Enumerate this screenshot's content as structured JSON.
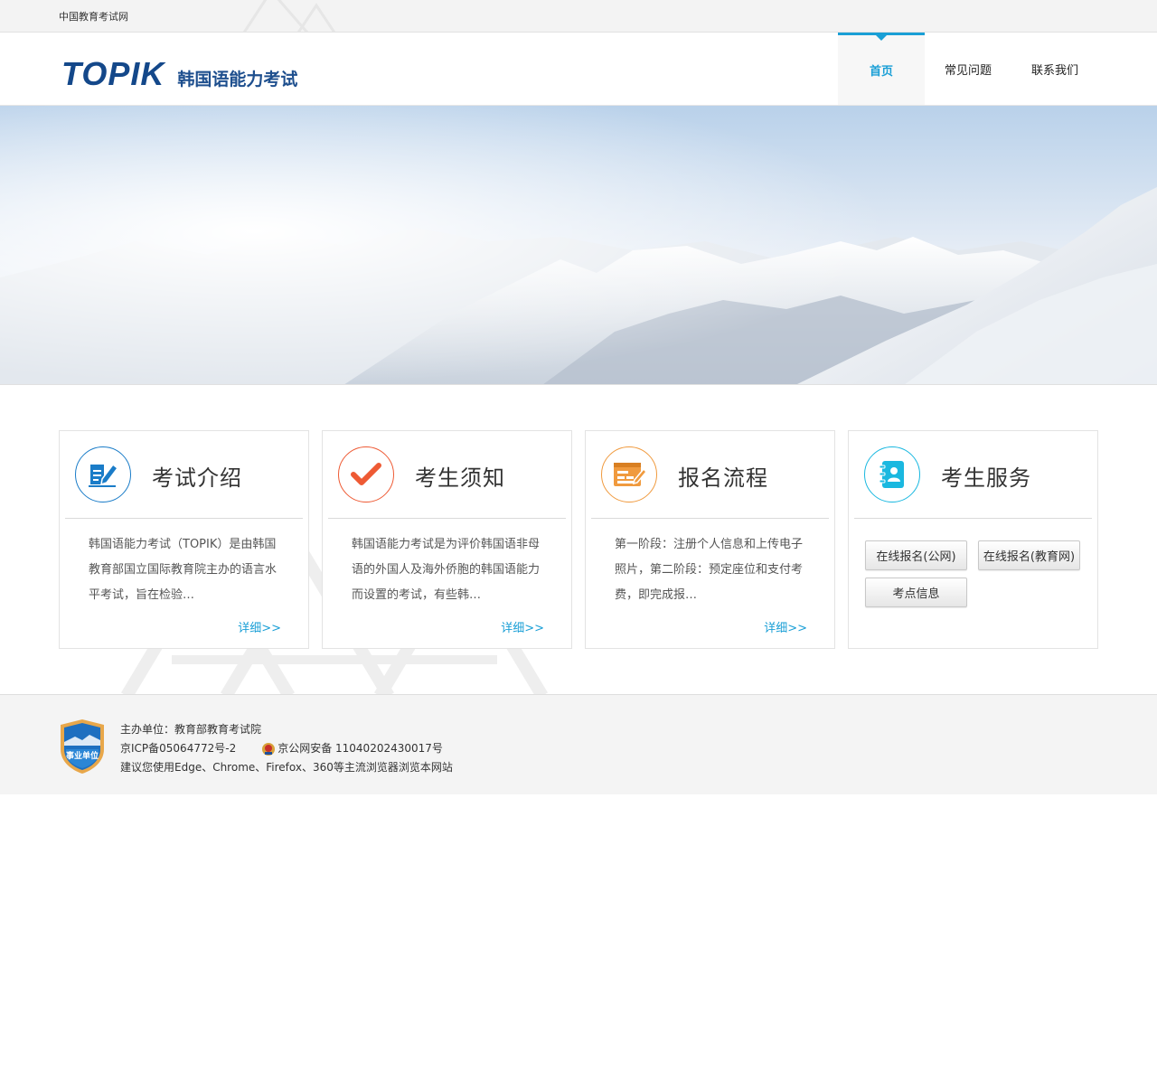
{
  "topbar": {
    "site_name": "中国教育考试网"
  },
  "header": {
    "logo_mark": "TOPIK",
    "logo_name": "韩国语能力考试",
    "nav": [
      {
        "label": "首页",
        "active": true
      },
      {
        "label": "常见问题",
        "active": false
      },
      {
        "label": "联系我们",
        "active": false
      }
    ]
  },
  "cards": [
    {
      "title": "考试介绍",
      "icon": "document-edit-icon",
      "color": "#1a7cc8",
      "text": "韩国语能力考试（TOPIK）是由韩国教育部国立国际教育院主办的语言水平考试，旨在检验…",
      "more": "详细>>"
    },
    {
      "title": "考生须知",
      "icon": "checkmark-icon",
      "color": "#ee5a34",
      "text": "韩国语能力考试是为评价韩国语非母语的外国人及海外侨胞的韩国语能力而设置的考试，有些韩…",
      "more": "详细>>"
    },
    {
      "title": "报名流程",
      "icon": "form-edit-icon",
      "color": "#f09a3e",
      "text": "第一阶段：注册个人信息和上传电子照片，第二阶段：预定座位和支付考费，即完成报…",
      "more": "详细>>"
    },
    {
      "title": "考生服务",
      "icon": "address-book-icon",
      "color": "#1ab8e0",
      "buttons": [
        "在线报名(公网)",
        "在线报名(教育网)",
        "考点信息"
      ]
    }
  ],
  "footer": {
    "host": "主办单位：教育部教育考试院",
    "icp": "京ICP备05064772号-2",
    "police_record": "京公网安备 11040202430017号",
    "browser_tip": "建议您使用Edge、Chrome、Firefox、360等主流浏览器浏览本网站",
    "badge_text": "事业单位"
  }
}
